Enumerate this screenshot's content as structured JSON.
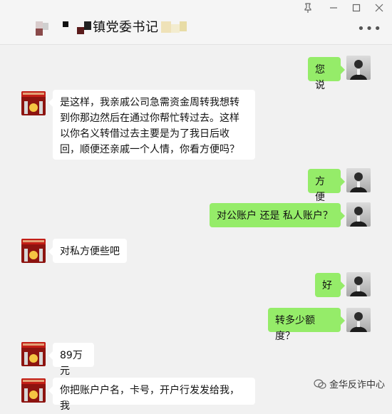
{
  "window": {
    "title": "镇党委书记",
    "more_icon": "more-horizontal-icon",
    "controls": [
      "pin-icon",
      "minimize-icon",
      "maximize-icon",
      "close-icon"
    ]
  },
  "messages": [
    {
      "from": "me",
      "text": "您说"
    },
    {
      "from": "contact",
      "text": "是这样，我亲戚公司急需资金周转我想转到你那边然后在通过你帮忙转过去。这样以你名义转借过去主要是为了我日后收回，顺便还亲戚一个人情，你看方便吗？"
    },
    {
      "from": "me",
      "text": "方便"
    },
    {
      "from": "me",
      "text": "对公账户 还是 私人账户？"
    },
    {
      "from": "contact",
      "text": "对私方便些吧"
    },
    {
      "from": "me",
      "text": "好"
    },
    {
      "from": "me",
      "text": "转多少额度？"
    },
    {
      "from": "contact",
      "text": "89万元"
    },
    {
      "from": "contact",
      "text": "你把账户户名，卡号，开户行发发给我，我"
    }
  ],
  "watermark": {
    "text": "金华反诈中心",
    "icon": "wechat-official-account-icon"
  },
  "colors": {
    "out_bubble": "#95ec69",
    "in_bubble": "#ffffff",
    "background": "#f1f1f1",
    "party_red": "#8d1410"
  }
}
